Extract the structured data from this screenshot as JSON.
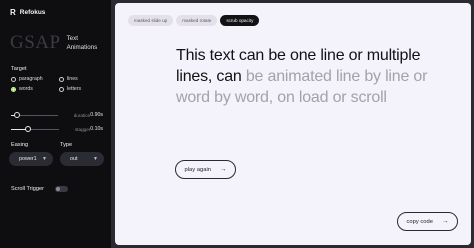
{
  "app": {
    "name": "Refokus",
    "logo_glyph": "R"
  },
  "brand": {
    "big": "GSAP",
    "sub_line1": "Text",
    "sub_line2": "Animations"
  },
  "sidebar": {
    "target_label": "Target",
    "target_options": [
      {
        "label": "paragraph",
        "checked": false
      },
      {
        "label": "lines",
        "checked": false
      },
      {
        "label": "words",
        "checked": true
      },
      {
        "label": "letters",
        "checked": false
      }
    ],
    "sliders": [
      {
        "name": "duration",
        "value": "0.90s",
        "level": 0.12
      },
      {
        "name": "stagger",
        "value": "0.10s",
        "level": 0.36
      }
    ],
    "easing_label": "Easing",
    "type_label": "Type",
    "easing_value": "power1",
    "type_value": "out",
    "scroll_trigger_label": "Scroll Trigger",
    "scroll_trigger_on": false
  },
  "tabs": [
    {
      "label": "masked slide up",
      "active": false
    },
    {
      "label": "masked rotate",
      "active": false
    },
    {
      "label": "scrub opacity",
      "active": true
    }
  ],
  "headline": {
    "dark": "This text can be one line or multiple lines, can",
    "dim": "be animated line by line or word by word, on load or scroll"
  },
  "buttons": {
    "play": "play again",
    "copy": "copy code"
  },
  "colors": {
    "accent": "#c8f5a0",
    "sidebar_bg": "#0e0e10",
    "panel_bg": "#f4f2fa"
  }
}
